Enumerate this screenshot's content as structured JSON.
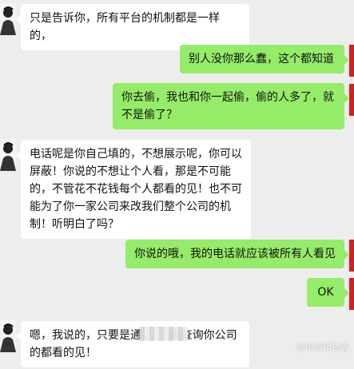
{
  "messages": [
    {
      "side": "left",
      "text": "只是告诉你，所有平台的机制都是一样的，"
    },
    {
      "side": "right",
      "text": "别人没你那么蠢，这个都知道"
    },
    {
      "side": "right",
      "text": "你去偷，我也和你一起偷，偷的人多了，就不是偷了？"
    },
    {
      "side": "left",
      "text": "电话呢是你自己填的，不想展示呢，你可以屏蔽！你说的不想让个人看，那是不可能的，不管花不花钱每个人都看的见！也不可能为了你一家公司来改我们整个公司的机制！听明白了吗？"
    },
    {
      "side": "right",
      "text": "你说的哦，我的电话就应该被所有人看见"
    },
    {
      "side": "right",
      "text": "OK"
    },
    {
      "side": "left",
      "text": "嗯，我说的，只要是通        来查询你公司的都看的见！"
    }
  ],
  "watermark": "@电话销售者",
  "colors": {
    "background": "#ededed",
    "right_bubble": "#95ec69",
    "left_bubble": "#ffffff",
    "avatar_right": "#d42020"
  }
}
